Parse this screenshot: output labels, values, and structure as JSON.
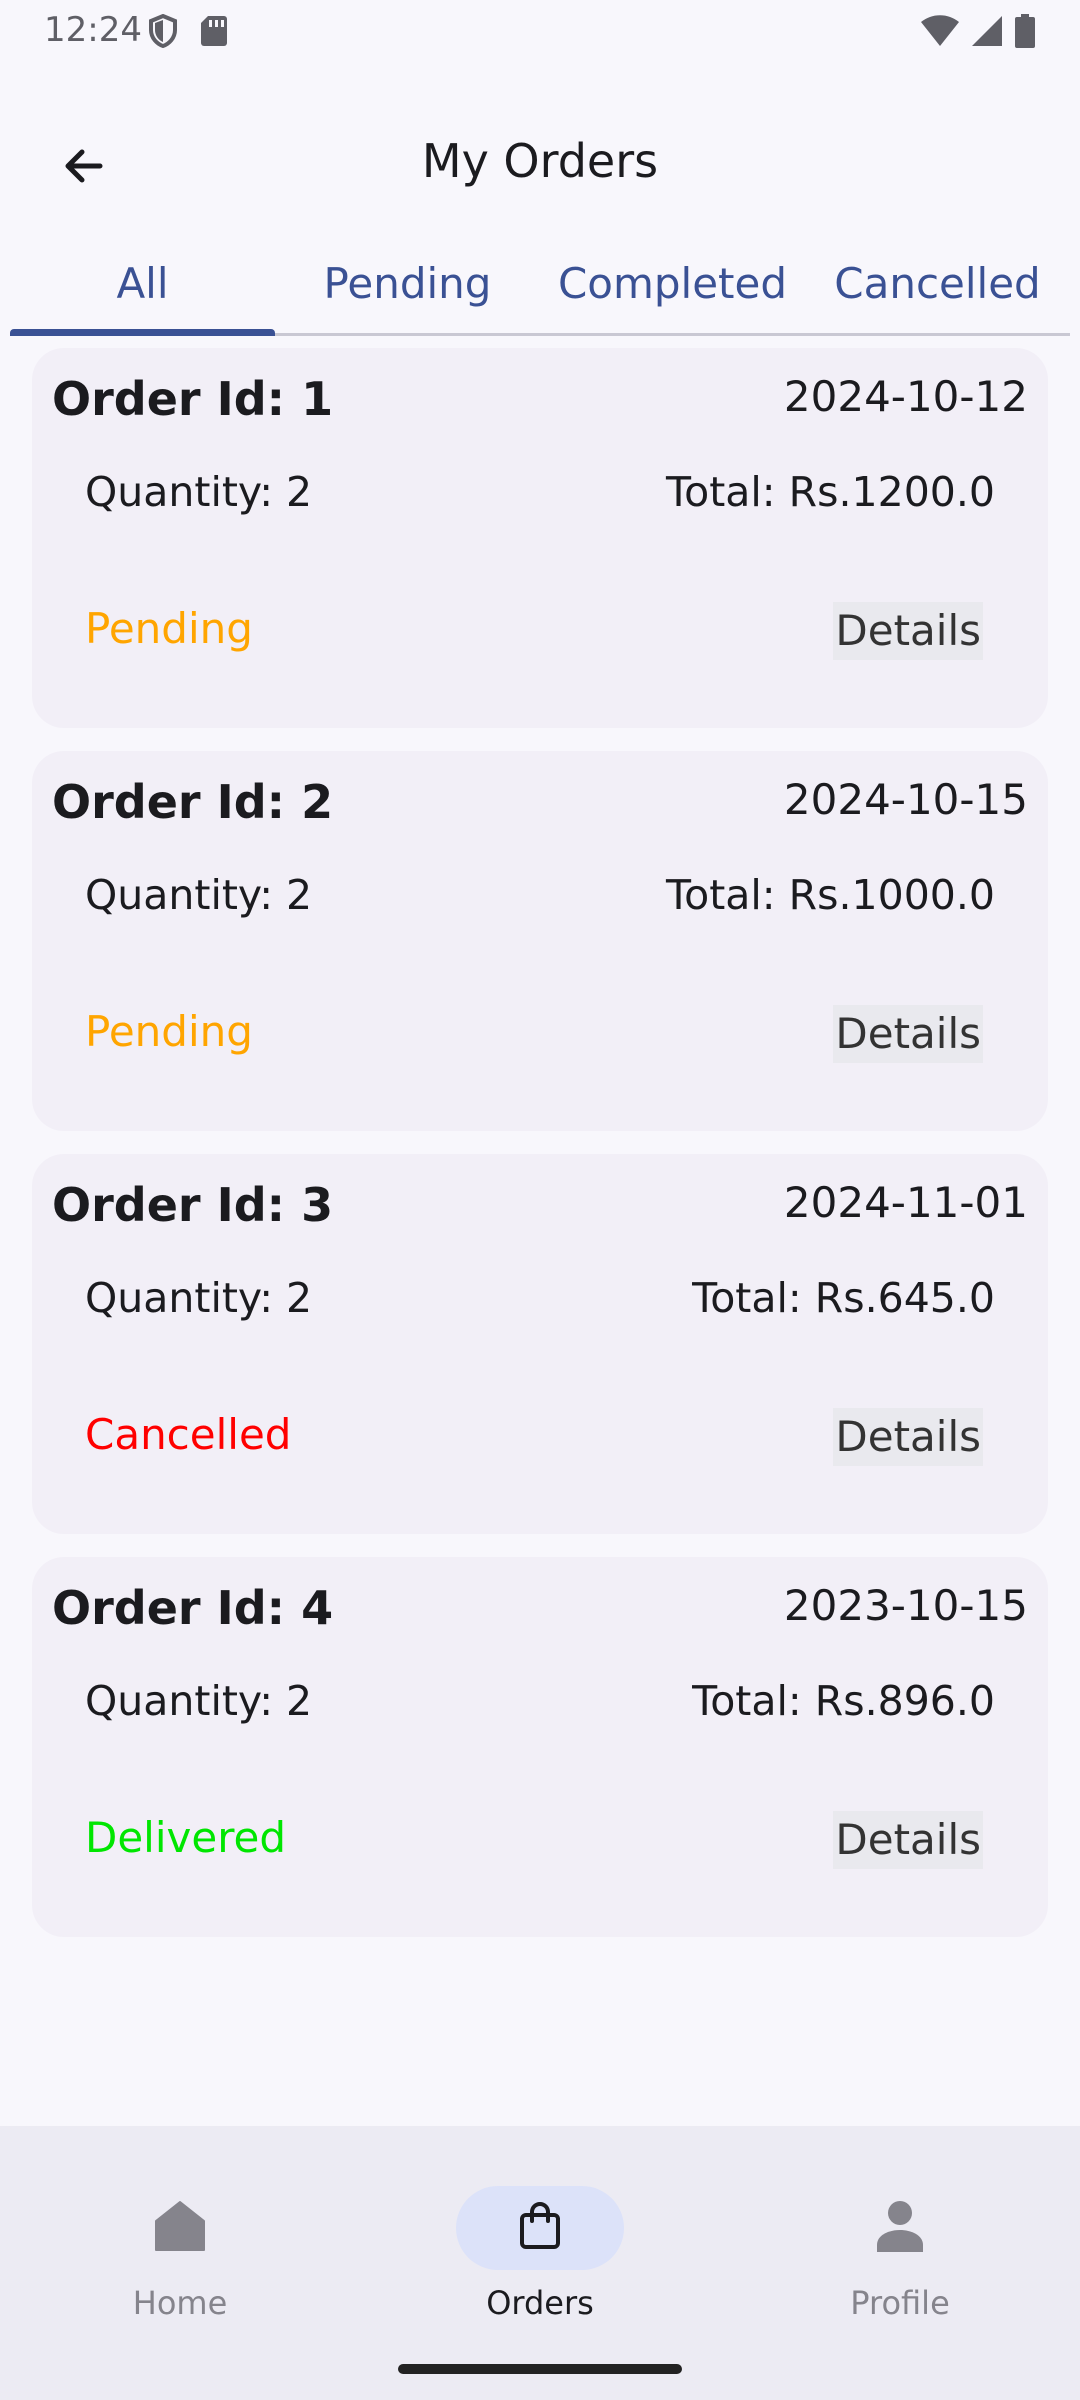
{
  "status_bar": {
    "time": "12:24",
    "icons": [
      "shield-icon",
      "sim-card-icon",
      "wifi-icon",
      "signal-icon",
      "battery-icon"
    ]
  },
  "app_bar": {
    "title": "My Orders",
    "back_icon": "arrow-back-icon"
  },
  "tabs": [
    {
      "label": "All",
      "selected": true
    },
    {
      "label": "Pending",
      "selected": false
    },
    {
      "label": "Completed",
      "selected": false
    },
    {
      "label": "Cancelled",
      "selected": false
    }
  ],
  "orders": [
    {
      "id": "Order Id: 1",
      "date": "2024-10-12",
      "quantity": "Quantity: 2",
      "total": "Total: Rs.1200.0",
      "status": "Pending",
      "status_color": "#ffa500",
      "details_label": "Details"
    },
    {
      "id": "Order Id: 2",
      "date": "2024-10-15",
      "quantity": "Quantity: 2",
      "total": "Total: Rs.1000.0",
      "status": "Pending",
      "status_color": "#ffa500",
      "details_label": "Details"
    },
    {
      "id": "Order Id: 3",
      "date": "2024-11-01",
      "quantity": "Quantity: 2",
      "total": "Total: Rs.645.0",
      "status": "Cancelled",
      "status_color": "#ff0000",
      "details_label": "Details"
    },
    {
      "id": "Order Id: 4",
      "date": "2023-10-15",
      "quantity": "Quantity: 2",
      "total": "Total: Rs.896.0",
      "status": "Delivered",
      "status_color": "#00e600",
      "details_label": "Details"
    }
  ],
  "bottom_nav": [
    {
      "label": "Home",
      "icon": "home-icon",
      "active": false
    },
    {
      "label": "Orders",
      "icon": "shopping-bag-icon",
      "active": true
    },
    {
      "label": "Profile",
      "icon": "person-icon",
      "active": false
    }
  ],
  "colors": {
    "accent": "#3a5194",
    "background": "#f8f7fc",
    "card": "#f2eff7",
    "nav_background": "#ecebf3",
    "nav_active_pill": "#dce2f9"
  }
}
